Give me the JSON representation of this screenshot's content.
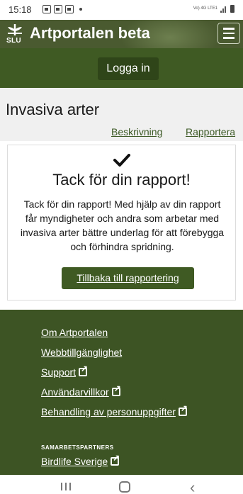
{
  "status_bar": {
    "time": "15:18",
    "network": "Vo) 4G LTE1",
    "icons": [
      "image-icon",
      "message-icon",
      "square-icon",
      "dot-icon",
      "signal-icon",
      "battery-icon"
    ]
  },
  "header": {
    "logo_text": "SLU",
    "title": "Artportalen beta",
    "menu_icon": "hamburger-icon"
  },
  "login": {
    "label": "Logga in"
  },
  "section": {
    "title": "Invasiva arter",
    "tabs": [
      {
        "label": "Beskrivning"
      },
      {
        "label": "Rapportera"
      }
    ]
  },
  "confirmation": {
    "icon": "checkmark-icon",
    "title": "Tack för din rapport!",
    "line1": "Tack för din rapport! Med hjälp av din rapport",
    "line2": "får myndigheter och andra som arbetar med",
    "line3": "invasiva arter bättre underlag för att förebygga",
    "line4": "och förhindra spridning.",
    "back_label": "Tillbaka till rapportering"
  },
  "footer": {
    "links": [
      {
        "label": "Om Artportalen",
        "external": false
      },
      {
        "label": "Webbtillgänglighet",
        "external": false
      },
      {
        "label": "Support",
        "external": true
      },
      {
        "label": "Användarvillkor",
        "external": true
      },
      {
        "label": "Behandling av personuppgifter",
        "external": true
      }
    ],
    "partners_heading": "Samarbetspartners",
    "partners": [
      {
        "label": "Birdlife Sverige",
        "external": true
      }
    ]
  },
  "colors": {
    "brand_green": "#4a5a30",
    "button_green": "#3f5a23",
    "footer_green": "#3d5424"
  }
}
